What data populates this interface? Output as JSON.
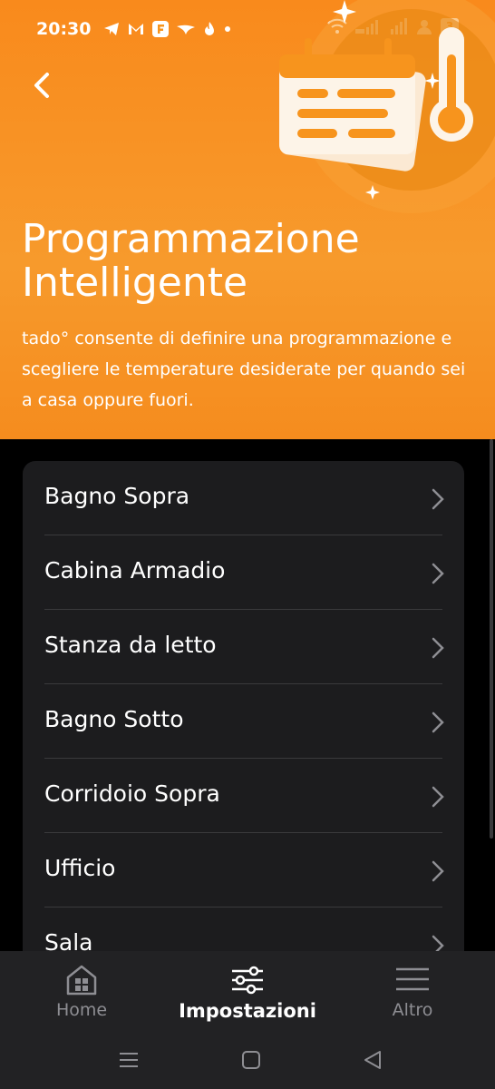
{
  "status": {
    "time": "20:30",
    "battery": "3"
  },
  "header": {
    "title_line1": "Programmazione",
    "title_line2": "Intelligente",
    "subtitle": "tado° consente di definire una programmazione e scegliere le temperature desiderate per quando sei a casa oppure fuori.",
    "accent": "#f7941d"
  },
  "rooms": [
    {
      "label": "Bagno Sopra"
    },
    {
      "label": "Cabina Armadio"
    },
    {
      "label": "Stanza da letto"
    },
    {
      "label": "Bagno Sotto"
    },
    {
      "label": "Corridoio Sopra"
    },
    {
      "label": "Ufficio"
    },
    {
      "label": "Sala"
    }
  ],
  "tabs": {
    "home": "Home",
    "settings": "Impostazioni",
    "more": "Altro"
  }
}
